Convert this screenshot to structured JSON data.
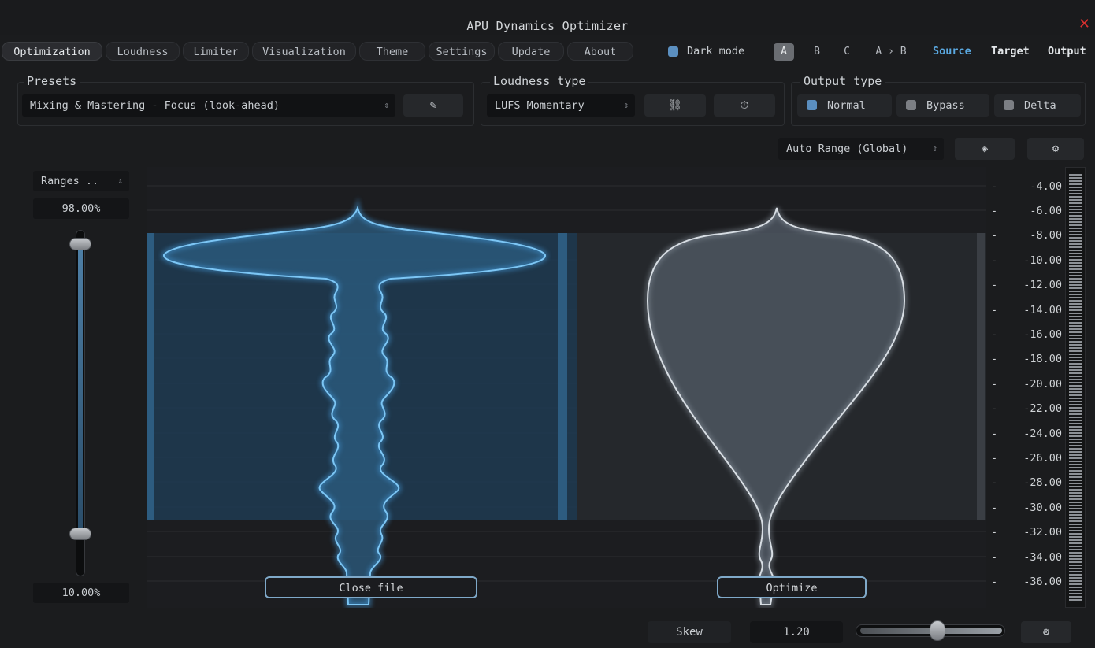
{
  "app": {
    "title": "APU Dynamics Optimizer"
  },
  "tabs": [
    "Optimization",
    "Loudness",
    "Limiter",
    "Visualization",
    "Theme",
    "Settings",
    "Update",
    "About"
  ],
  "header": {
    "dark_mode_label": "Dark mode",
    "ab_buttons": [
      "A",
      "B",
      "C",
      "A › B"
    ],
    "views": [
      "Source",
      "Target",
      "Output"
    ]
  },
  "presets": {
    "label": "Presets",
    "value": "Mixing & Mastering - Focus (look-ahead)"
  },
  "loudness": {
    "label": "Loudness type",
    "value": "LUFS Momentary"
  },
  "output_type": {
    "label": "Output type",
    "options": [
      "Normal",
      "Bypass",
      "Delta"
    ],
    "selected": "Normal"
  },
  "range": {
    "mode": "Auto Range (Global)"
  },
  "ranges": {
    "label": "Ranges ..",
    "upper": "98.00%",
    "lower": "10.00%"
  },
  "scale": [
    "-4.00",
    "-6.00",
    "-8.00",
    "-10.00",
    "-12.00",
    "-14.00",
    "-16.00",
    "-18.00",
    "-20.00",
    "-22.00",
    "-24.00",
    "-26.00",
    "-28.00",
    "-30.00",
    "-32.00",
    "-34.00",
    "-36.00"
  ],
  "buttons": {
    "close_file": "Close file",
    "optimize": "Optimize"
  },
  "skew": {
    "label": "Skew",
    "value": "1.20"
  },
  "colors": {
    "accent": "#5aa8e0",
    "source_fill": "#27506f",
    "target_fill": "#4c5560",
    "close": "#d9302f"
  }
}
